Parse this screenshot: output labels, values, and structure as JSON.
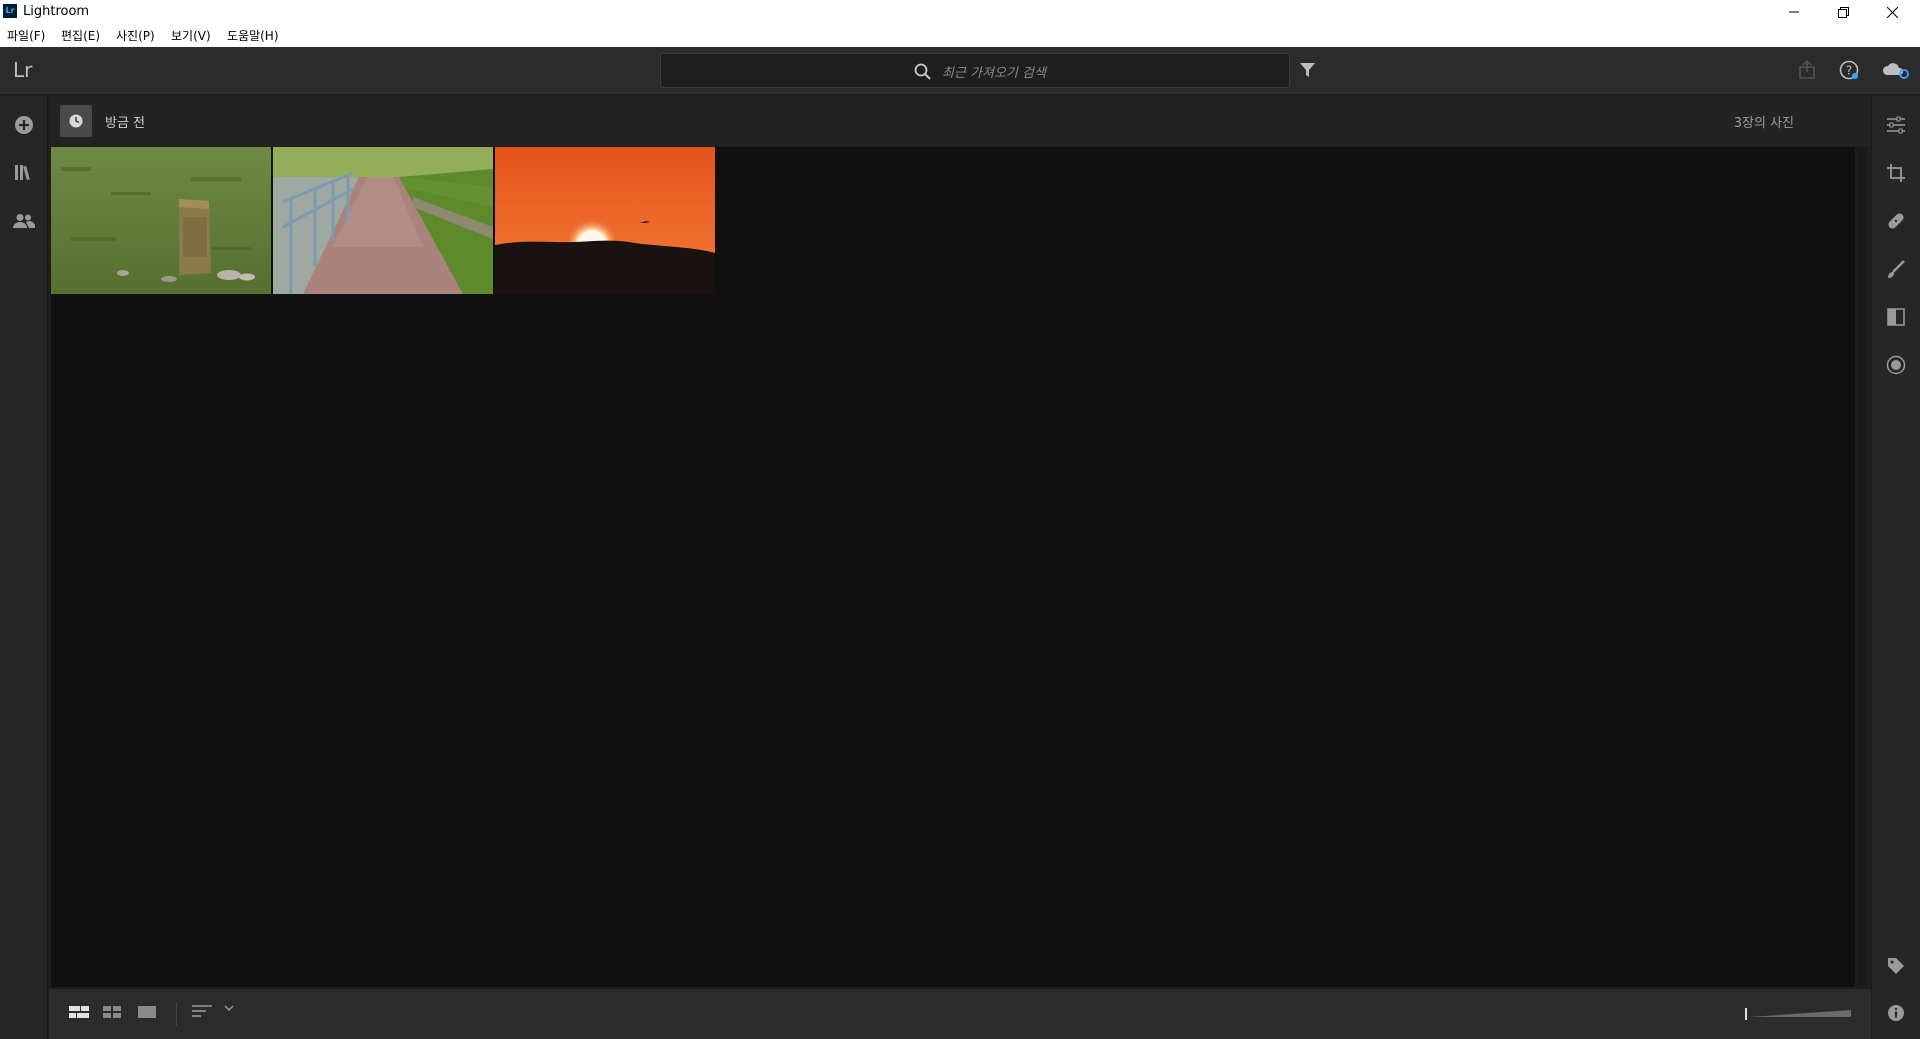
{
  "window": {
    "app_icon_text": "Lr",
    "title": "Lightroom"
  },
  "menu": [
    "파일(F)",
    "편집(E)",
    "사진(P)",
    "보기(V)",
    "도움말(H)"
  ],
  "topbar": {
    "logo": "Lr",
    "search_placeholder": "최근 가져오기 검색"
  },
  "header": {
    "label": "방금 전",
    "photo_count": "3장의 사진"
  },
  "photos": [
    {
      "subject": "stone marker in grass",
      "colors": [
        "#5f7a3a",
        "#8a9a52",
        "#7b6a3e"
      ]
    },
    {
      "subject": "paved path with railing",
      "colors": [
        "#6f8f3a",
        "#b28982",
        "#a0a8a0"
      ]
    },
    {
      "subject": "orange sunset over hill",
      "colors": [
        "#e2541c",
        "#f17234",
        "#1a1210"
      ]
    }
  ],
  "colors": {
    "accent": "#31a8ff",
    "panel": "#262626",
    "grid_bg": "#101010"
  }
}
